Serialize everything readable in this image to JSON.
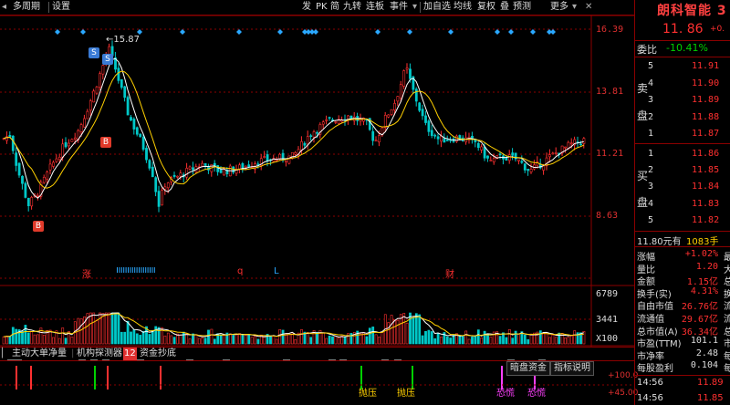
{
  "toolbar": {
    "left_items": [
      "多周期",
      "设置"
    ],
    "right_items": [
      "发",
      "PK",
      "简",
      "九转",
      "连板",
      "事件",
      "加自选",
      "均线",
      "复权",
      "叠",
      "预测",
      "更多"
    ],
    "icons": [
      "left-arrow-icon",
      "chevron-down-icon",
      "minus-circle-icon",
      "eye-icon",
      "target-icon",
      "lock-icon",
      "pen-icon",
      "close-icon"
    ]
  },
  "price_axis": [
    "16.39",
    "13.81",
    "11.21",
    "8.63"
  ],
  "volume_axis": [
    "6789",
    "3441",
    "X100"
  ],
  "annotations": {
    "high_label": "15.87",
    "markers": [
      "S",
      "S",
      "B",
      "B"
    ],
    "events": [
      "涨",
      "q",
      "L",
      "财"
    ]
  },
  "indicator_tabs": [
    {
      "label": "主动大单净量"
    },
    {
      "label": "机构探测器"
    },
    {
      "label": "12",
      "highlight": true
    },
    {
      "label": "资金抄底"
    }
  ],
  "bottom_buttons": [
    "暗盘资金",
    "指标说明"
  ],
  "bottom_scale": [
    "100.0",
    "45.00"
  ],
  "bottom_tags": [
    "抛压",
    "抛压",
    "恐慌",
    "恐慌"
  ],
  "right_panel": {
    "title": "朗科智能 3",
    "price": "11. 86",
    "change": "+0.",
    "weibi_label": "委比",
    "weibi_value": "-10.41%",
    "sell_label_1": "卖",
    "sell_label_2": "盘",
    "buy_label_1": "买",
    "buy_label_2": "盘",
    "sell": [
      {
        "n": "5",
        "p": "11.91"
      },
      {
        "n": "4",
        "p": "11.90"
      },
      {
        "n": "3",
        "p": "11.89"
      },
      {
        "n": "2",
        "p": "11.88"
      },
      {
        "n": "1",
        "p": "11.87"
      }
    ],
    "buy": [
      {
        "n": "1",
        "p": "11.86"
      },
      {
        "n": "2",
        "p": "11.85"
      },
      {
        "n": "3",
        "p": "11.84"
      },
      {
        "n": "4",
        "p": "11.83"
      },
      {
        "n": "5",
        "p": "11.82"
      }
    ],
    "trade_line": "11.80元有",
    "trade_vol": "1083手",
    "stats": [
      {
        "label": "涨幅",
        "value": "+1.02%",
        "extra": "最",
        "color": "red"
      },
      {
        "label": "量比",
        "value": "1.20",
        "extra": "大",
        "color": "red"
      },
      {
        "label": "金额",
        "value": "1.15亿",
        "extra": "总",
        "color": "red"
      },
      {
        "label": "换手(实)",
        "value": "4.31%",
        "extra": "换",
        "color": "red"
      },
      {
        "label": "自由市值",
        "value": "26.76亿",
        "extra": "流",
        "color": "red"
      },
      {
        "label": "流通值",
        "value": "29.67亿",
        "extra": "流",
        "color": "red"
      },
      {
        "label": "总市值(A)",
        "value": "36.34亿",
        "extra": "总",
        "color": "red"
      },
      {
        "label": "市盈(TTM)",
        "value": "101.1",
        "extra": "市",
        "color": "white"
      },
      {
        "label": "市净率",
        "value": "2.48",
        "extra": "每",
        "color": "white"
      },
      {
        "label": "每股盈利",
        "value": "0.104",
        "extra": "每",
        "color": "white"
      }
    ],
    "ticks": [
      {
        "time": "14:56",
        "price": "11.89"
      },
      {
        "time": "14:56",
        "price": "11.85"
      }
    ]
  },
  "colors": {
    "up": "#ff3030",
    "down": "#00c8c8",
    "ma_white": "#ffffff",
    "ma_yellow": "#ffd000",
    "ma_pink": "#ff40ff",
    "frame": "#8b0000"
  }
}
